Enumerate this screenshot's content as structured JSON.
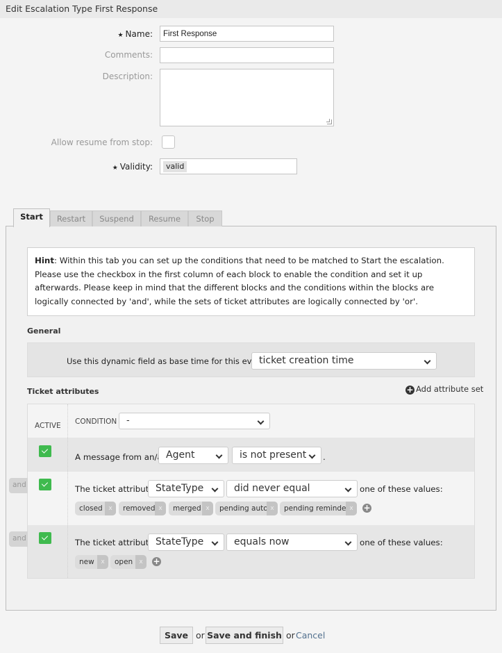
{
  "header": {
    "title": "Edit Escalation Type First Response"
  },
  "form": {
    "name": {
      "label": "Name:",
      "value": "First Response",
      "required": true
    },
    "comments": {
      "label": "Comments:",
      "value": ""
    },
    "description": {
      "label": "Description:",
      "value": ""
    },
    "allow_resume": {
      "label": "Allow resume from stop:",
      "checked": false
    },
    "validity": {
      "label": "Validity:",
      "value": "valid",
      "required": true
    }
  },
  "tabs": [
    {
      "label": "Start",
      "active": true
    },
    {
      "label": "Restart",
      "active": false
    },
    {
      "label": "Suspend",
      "active": false
    },
    {
      "label": "Resume",
      "active": false
    },
    {
      "label": "Stop",
      "active": false
    }
  ],
  "hint": {
    "bold": "Hint",
    "text": ": Within this tab you can set up the conditions that need to be matched to Start the escalation. Please use the checkbox in the first column of each block to enable the condition and set it up afterwards. Please keep in mind that the different blocks and the conditions within the blocks are logically connected by 'and', while the sets of ticket attributes are logically connected by 'or'."
  },
  "general": {
    "heading": "General",
    "base_time_label": "Use this dynamic field as base time for this event:",
    "base_time_value": "ticket creation time"
  },
  "ticket_attributes": {
    "heading": "Ticket attributes",
    "add_set_label": "Add attribute set",
    "col_active": "ACTIVE",
    "col_condition": "CONDITION",
    "condition_value": "-",
    "rows": [
      {
        "active": true,
        "prefix": "A message from an/a",
        "select1": "Agent",
        "select2": "is not present",
        "suffix": "."
      },
      {
        "active": true,
        "connector": "and",
        "prefix": "The ticket attribute",
        "select1": "StateType",
        "select2": "did never equal",
        "suffix": "one of these values:",
        "values": [
          "closed",
          "removed",
          "merged",
          "pending auto",
          "pending reminder"
        ]
      },
      {
        "active": true,
        "connector": "and",
        "prefix": "The ticket attribute",
        "select1": "StateType",
        "select2": "equals now",
        "suffix": "one of these values:",
        "values": [
          "new",
          "open"
        ]
      }
    ],
    "remove_label": "x"
  },
  "footer": {
    "save": "Save",
    "or1": "or",
    "save_finish": "Save and finish",
    "or2": "or",
    "cancel": "Cancel"
  }
}
